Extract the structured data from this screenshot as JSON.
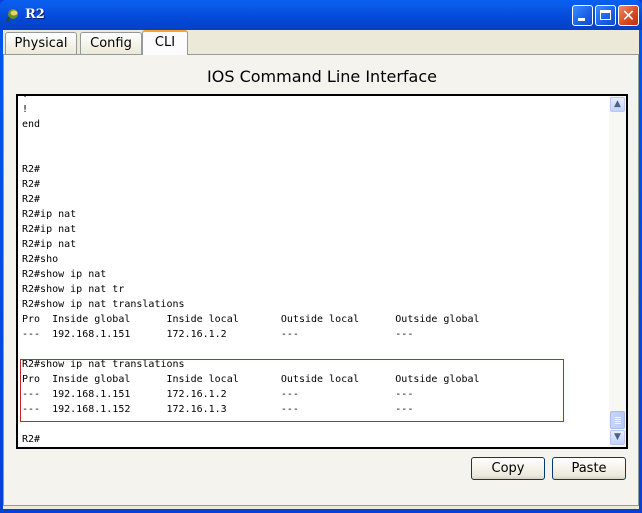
{
  "window": {
    "title": "R2",
    "controls": {
      "minimize": "minimize",
      "maximize": "maximize",
      "close": "close"
    }
  },
  "tabs": [
    {
      "label": "Physical",
      "active": false
    },
    {
      "label": "Config",
      "active": false
    },
    {
      "label": "CLI",
      "active": true
    }
  ],
  "panel": {
    "title": "IOS Command Line Interface"
  },
  "terminal": {
    "lines": [
      "!",
      "!",
      "end",
      "",
      "",
      "R2#",
      "R2#",
      "R2#",
      "R2#ip nat",
      "R2#ip nat",
      "R2#ip nat",
      "R2#sho",
      "R2#show ip nat",
      "R2#show ip nat tr",
      "R2#show ip nat translations",
      "Pro  Inside global      Inside local       Outside local      Outside global",
      "---  192.168.1.151      172.16.1.2         ---                ---",
      "",
      "R2#show ip nat translations",
      "Pro  Inside global      Inside local       Outside local      Outside global",
      "---  192.168.1.151      172.16.1.2         ---                ---",
      "---  192.168.1.152      172.16.1.3         ---                ---",
      "",
      "R2#"
    ],
    "highlight_color": "#c0282a"
  },
  "buttons": {
    "copy": "Copy",
    "paste": "Paste"
  },
  "scrollbar": {
    "position_fraction": 1.0
  }
}
